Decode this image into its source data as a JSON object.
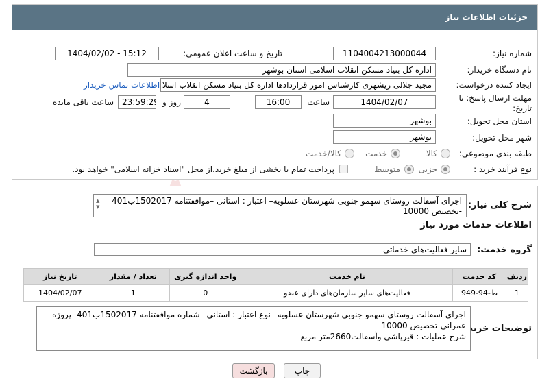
{
  "header": {
    "title": "جزئیات اطلاعات نیاز"
  },
  "form": {
    "need_number_label": "شماره نیاز:",
    "need_number": "1104004213000044",
    "announce_label": "تاریخ و ساعت اعلان عمومی:",
    "announce_value": "1404/02/02 - 15:12",
    "buyer_org_label": "نام دستگاه خریدار:",
    "buyer_org": "اداره کل بنیاد مسکن انقلاب اسلامی استان بوشهر",
    "creator_label": "ایجاد کننده درخواست:",
    "creator": "مجید جلالی ریشهری کارشناس امور قراردادها اداره کل بنیاد مسکن انقلاب اسلا",
    "contact_link": "اطلاعات تماس خریدار",
    "deadline_label_1": "مهلت ارسال پاسخ: تا",
    "deadline_label_2": "تاریخ:",
    "deadline_date": "1404/02/07",
    "time_label": "ساعت",
    "deadline_time": "16:00",
    "days_value": "4",
    "days_label": "روز و",
    "remaining_time": "23:59:29",
    "remaining_label": "ساعت باقی مانده",
    "province_label": "استان محل تحویل:",
    "province": "بوشهر",
    "city_label": "شهر محل تحویل:",
    "city": "بوشهر",
    "category_label": "طبقه بندی موضوعی:",
    "category_options": [
      "کالا",
      "خدمت",
      "کالا/خدمت"
    ],
    "category_selected": "خدمت",
    "process_label": "نوع فرآیند خرید :",
    "process_options": [
      "جزیی",
      "متوسط"
    ],
    "process_selected": "جزیی",
    "payment_note": "پرداخت تمام یا بخشی از مبلغ خرید،از محل \"اسناد خزانه اسلامی\" خواهد بود."
  },
  "summary": {
    "label": "شرح کلی نیاز:",
    "line1": "اجرای آسفالت روستای سهمو جنوبی  شهرستان عسلویه– اعتبار : استانی –موافقتنامه 1502017ب401",
    "line2": "-تخصیص 10000"
  },
  "services": {
    "section_title": "اطلاعات خدمات مورد نیاز",
    "group_label": "گروه خدمت:",
    "group_value": "سایر فعالیت‌های خدماتی",
    "columns": [
      "ردیف",
      "کد خدمت",
      "نام خدمت",
      "واحد اندازه گیری",
      "تعداد / مقدار",
      "تاریخ نیاز"
    ],
    "rows": [
      [
        "1",
        "ط-94-949",
        "فعالیت‌های سایر سازمان‌های دارای عضو",
        "0",
        "1",
        "1404/02/07"
      ]
    ]
  },
  "buyer_notes": {
    "label": "توضیحات خریدار:",
    "line1": "اجرای آسفالت روستای سهمو جنوبی  شهرستان عسلویه– نوع اعتبار : استانی –شماره موافقتنامه 1502017ب401 -پروژه",
    "line2": "عمرانی-تخصیص 10000",
    "line3": "شرح عملیات : قیرپاشی وآسفالت2660متر مربع"
  },
  "buttons": {
    "print": "چاپ",
    "back": "بازگشت"
  },
  "colors": {
    "header_bg": "#5a7485",
    "back_button_bg": "#f6dede",
    "link": "#1f5fbf"
  }
}
